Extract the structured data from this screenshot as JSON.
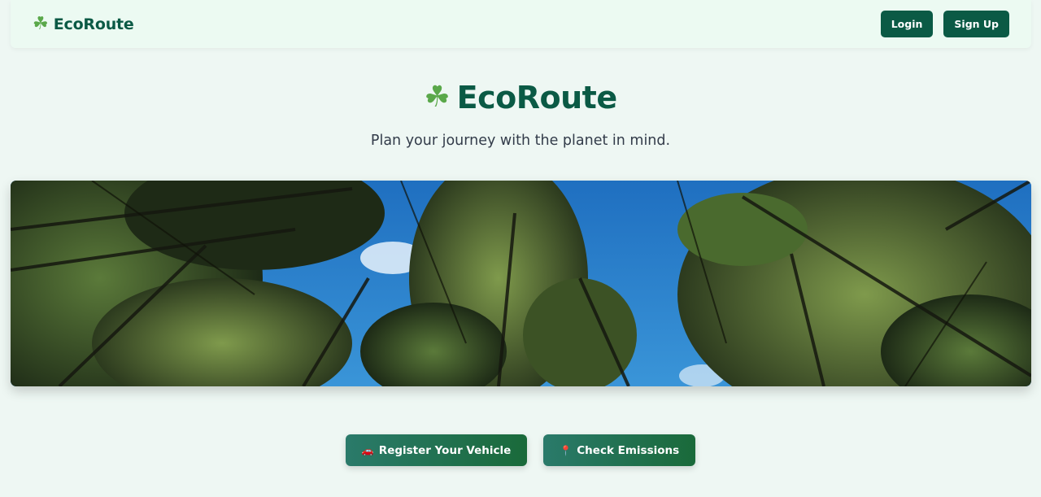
{
  "navbar": {
    "brand_icon": "shamrock-icon",
    "brand_glyph": "☘",
    "brand_name": "EcoRoute",
    "login_label": "Login",
    "signup_label": "Sign Up"
  },
  "hero": {
    "icon": "shamrock-icon",
    "glyph": "☘",
    "title": "EcoRoute",
    "tagline": "Plan your journey with the planet in mind."
  },
  "banner": {
    "image": "forest-canopy-looking-up-at-blue-sky"
  },
  "actions": {
    "register_icon": "car-icon",
    "register_glyph": "🚗",
    "register_label": "Register Your Vehicle",
    "emissions_icon": "pin-icon",
    "emissions_glyph": "📍",
    "emissions_label": "Check Emissions"
  },
  "colors": {
    "brand": "#0b5a45",
    "clover": "#5aa84a",
    "background": "#eef7f3",
    "cta_start": "#2a7a6a",
    "cta_end": "#1a6a3a"
  }
}
